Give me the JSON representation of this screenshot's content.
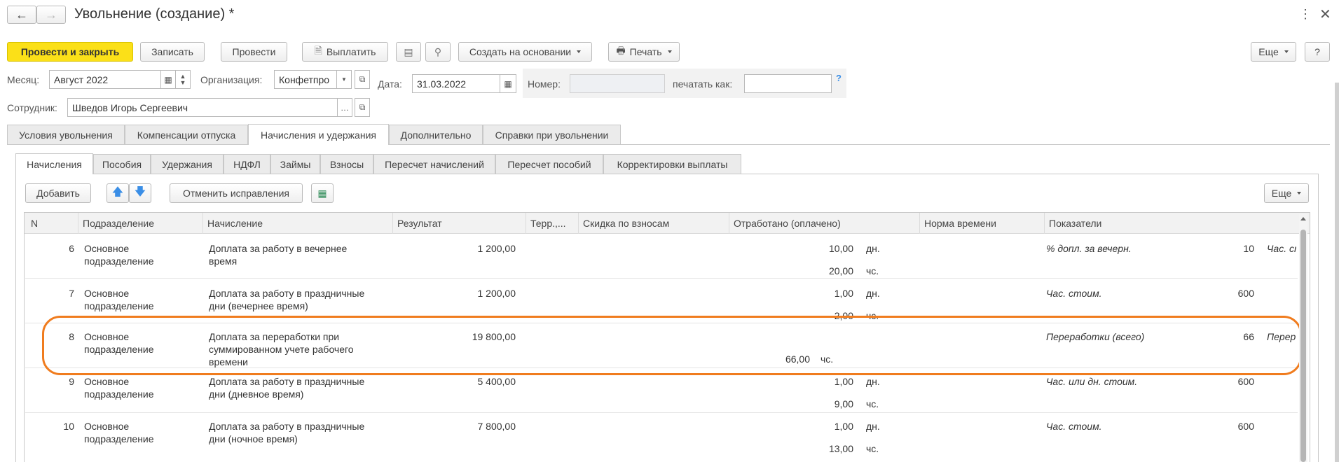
{
  "window": {
    "title": "Увольнение (создание) *"
  },
  "toolbar": {
    "post_close": "Провести и закрыть",
    "save": "Записать",
    "post": "Провести",
    "pay": "Выплатить",
    "create_based": "Создать на основании",
    "print": "Печать",
    "more": "Еще",
    "help": "?"
  },
  "form": {
    "month_label": "Месяц:",
    "month_value": "Август 2022",
    "org_label": "Организация:",
    "org_value": "Конфетпро",
    "date_label": "Дата:",
    "date_value": "31.03.2022",
    "number_label": "Номер:",
    "number_value": "",
    "print_as_label": "печатать как:",
    "print_as_value": "",
    "help_mark": "?",
    "employee_label": "Сотрудник:",
    "employee_value": "Шведов Игорь Сергеевич"
  },
  "main_tabs": [
    "Условия увольнения",
    "Компенсации отпуска",
    "Начисления и удержания",
    "Дополнительно",
    "Справки при увольнении"
  ],
  "sub_tabs": [
    "Начисления",
    "Пособия",
    "Удержания",
    "НДФЛ",
    "Займы",
    "Взносы",
    "Пересчет начислений",
    "Пересчет пособий",
    "Корректировки выплаты"
  ],
  "table_toolbar": {
    "add": "Добавить",
    "cancel_fix": "Отменить исправления",
    "more": "Еще"
  },
  "table": {
    "columns": [
      "N",
      "Подразделение",
      "Начисление",
      "Результат",
      "Терр.,...",
      "Скидка по взносам",
      "Отработано (оплачено)",
      "Норма времени",
      "Показатели"
    ],
    "rows": [
      {
        "n": "6",
        "dept1": "Основное",
        "dept2": "подразделение",
        "acc1": "Доплата за работу в вечернее",
        "acc2": "время",
        "acc3": "",
        "result": "1 200,00",
        "w1": "10,00",
        "u1": "дн.",
        "w2": "20,00",
        "u2": "чс.",
        "ind": "% допл. за вечерн.",
        "indv": "10",
        "ind2": "Час. ст"
      },
      {
        "n": "7",
        "dept1": "Основное",
        "dept2": "подразделение",
        "acc1": "Доплата за работу в праздничные",
        "acc2": "дни (вечернее время)",
        "acc3": "",
        "result": "1 200,00",
        "w1": "1,00",
        "u1": "дн.",
        "w2": "2,00",
        "u2": "чс.",
        "ind": "Час. стоим.",
        "indv": "600",
        "ind2": ""
      },
      {
        "n": "8",
        "dept1": "Основное",
        "dept2": "подразделение",
        "acc1": "Доплата за переработки при",
        "acc2": "суммированном учете рабочего",
        "acc3": "времени",
        "result": "19 800,00",
        "w1": "",
        "u1": "",
        "w2": "66,00",
        "u2": "чс.",
        "ind": "Переработки (всего)",
        "indv": "66",
        "ind2": "Перер"
      },
      {
        "n": "9",
        "dept1": "Основное",
        "dept2": "подразделение",
        "acc1": "Доплата за работу в праздничные",
        "acc2": "дни (дневное время)",
        "acc3": "",
        "result": "5 400,00",
        "w1": "1,00",
        "u1": "дн.",
        "w2": "9,00",
        "u2": "чс.",
        "ind": "Час. или дн. стоим.",
        "indv": "600",
        "ind2": ""
      },
      {
        "n": "10",
        "dept1": "Основное",
        "dept2": "подразделение",
        "acc1": "Доплата за работу в праздничные",
        "acc2": "дни (ночное время)",
        "acc3": "",
        "result": "7 800,00",
        "w1": "1,00",
        "u1": "дн.",
        "w2": "13,00",
        "u2": "чс.",
        "ind": "Час. стоим.",
        "indv": "600",
        "ind2": ""
      }
    ]
  },
  "colors": {
    "primary": "#fbe018",
    "highlight": "#f07c1e",
    "arrow": "#3a8ee6"
  }
}
